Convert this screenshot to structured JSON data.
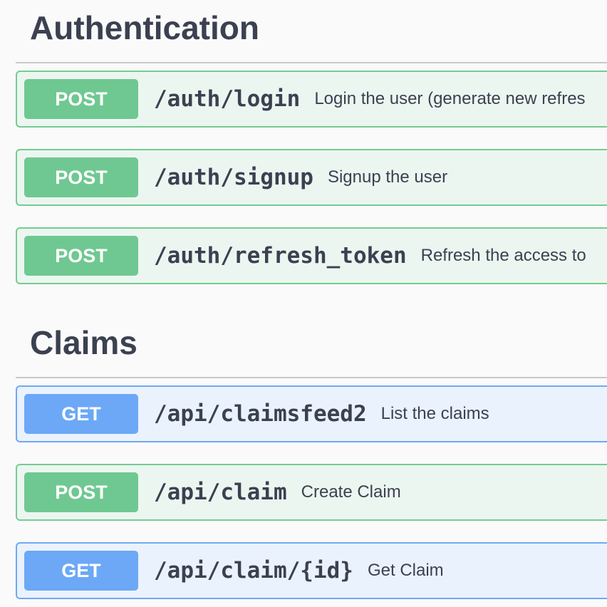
{
  "sections": [
    {
      "title": "Authentication",
      "operations": [
        {
          "method": "POST",
          "path": "/auth/login",
          "summary": "Login the user (generate new refres"
        },
        {
          "method": "POST",
          "path": "/auth/signup",
          "summary": "Signup the user"
        },
        {
          "method": "POST",
          "path": "/auth/refresh_token",
          "summary": "Refresh the access to"
        }
      ]
    },
    {
      "title": "Claims",
      "operations": [
        {
          "method": "GET",
          "path": "/api/claimsfeed2",
          "summary": "List the claims"
        },
        {
          "method": "POST",
          "path": "/api/claim",
          "summary": "Create Claim"
        },
        {
          "method": "GET",
          "path": "/api/claim/{id}",
          "summary": "Get Claim"
        }
      ]
    }
  ],
  "colors": {
    "post_bg": "#ecf6f0",
    "post_border": "#74cc92",
    "post_method": "#6fc891",
    "get_bg": "#eaf2fd",
    "get_border": "#6fa9f3",
    "get_method": "#6ca8f6",
    "text": "#3b4151"
  }
}
